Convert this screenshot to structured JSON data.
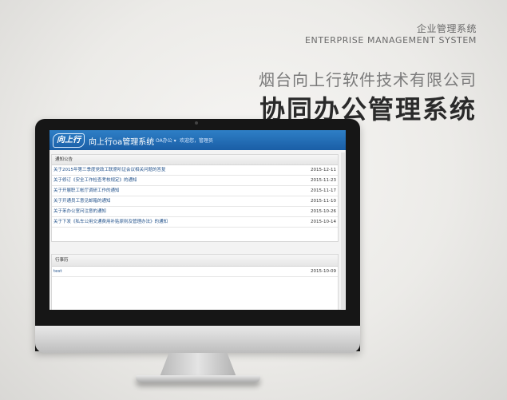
{
  "header": {
    "subtitle_cn": "企业管理系统",
    "subtitle_en": "ENTERPRISE MANAGEMENT SYSTEM",
    "company": "烟台向上行软件技术有限公司",
    "title": "协同办公管理系统"
  },
  "app": {
    "logo_text": "向上行",
    "name": "向上行oa管理系统",
    "menu_label": "OA办公 ▾",
    "welcome_text": "欢迎您，管理员"
  },
  "notices": {
    "title": "通知公告",
    "rows": [
      {
        "title": "关于2015年第三季度党政工联席听证会议相关问题的答复",
        "date": "2015-12-11"
      },
      {
        "title": "关于修订《安全工作检查考核规定》的通知",
        "date": "2015-11-23"
      },
      {
        "title": "关于开展职工帐厅调研工作的通知",
        "date": "2015-11-17"
      },
      {
        "title": "关于开通员工意见邮箱的通知",
        "date": "2015-11-10"
      },
      {
        "title": "关于苯办公室问注意的通知",
        "date": "2015-10-26"
      },
      {
        "title": "关于下发《私车公用交通费用补贴原则及管理办法》的通知",
        "date": "2015-10-14"
      }
    ]
  },
  "schedule": {
    "title": "行事历",
    "rows": [
      {
        "title": "test",
        "date": "2015-10-09"
      }
    ]
  },
  "colors": {
    "app_bar": "#1f67b1",
    "link": "#24538c",
    "title_dark": "#2a2a2a"
  }
}
